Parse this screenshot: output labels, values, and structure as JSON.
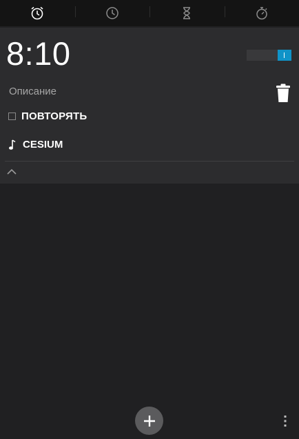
{
  "tabs": [
    {
      "icon": "alarm-clock-icon",
      "active": true
    },
    {
      "icon": "clock-icon",
      "active": false
    },
    {
      "icon": "hourglass-icon",
      "active": false
    },
    {
      "icon": "stopwatch-icon",
      "active": false
    }
  ],
  "alarm": {
    "time": "8:10",
    "enabled": true,
    "description_placeholder": "Описание",
    "repeat_label": "ПОВТОРЯТЬ",
    "repeat_checked": false,
    "ringtone": "CESIUM"
  },
  "colors": {
    "accent": "#0f93c8",
    "background": "#202022",
    "card": "#2c2c2e",
    "tabbar": "#141414"
  },
  "icons": {
    "delete": "trash-icon",
    "ringtone": "music-note-icon",
    "collapse": "chevron-up-icon",
    "add": "plus-icon",
    "menu": "overflow-menu-icon"
  }
}
